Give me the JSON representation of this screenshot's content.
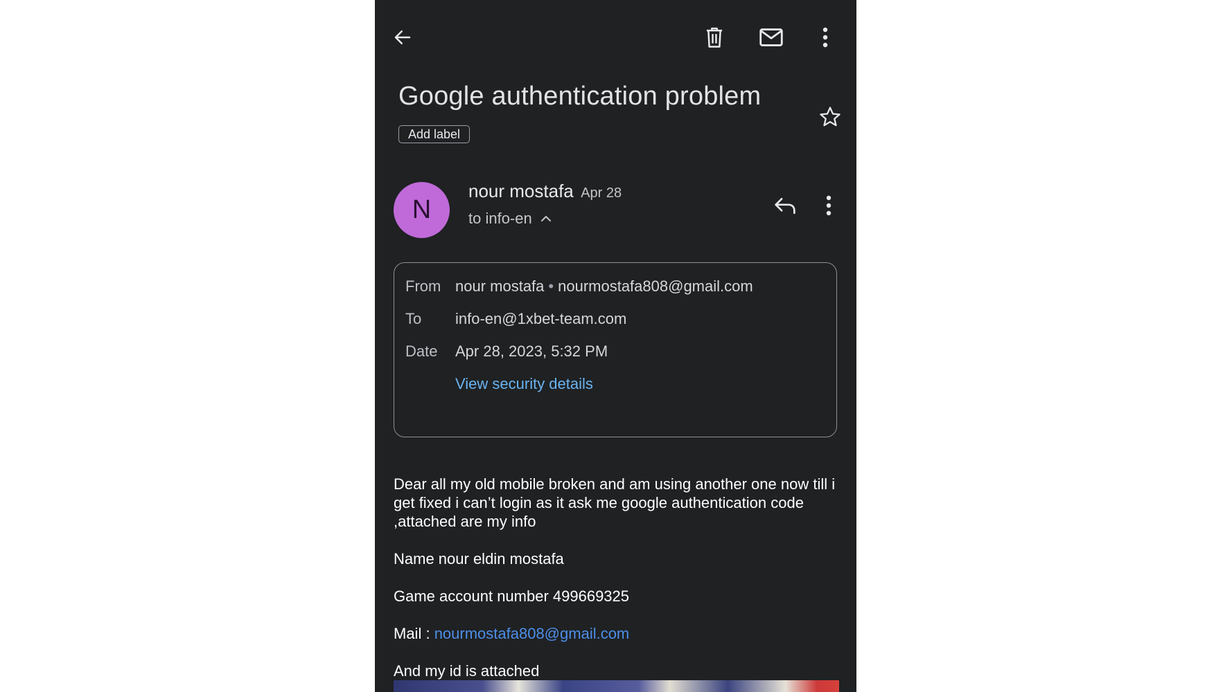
{
  "toolbar": {
    "back_icon": "arrow-left-icon",
    "delete_icon": "trash-icon",
    "mark_unread_icon": "mail-icon",
    "more_icon": "more-vert-icon"
  },
  "email": {
    "subject": "Google authentication problem",
    "add_label": "Add label",
    "star_icon": "star-outline-icon"
  },
  "sender": {
    "avatar_letter": "N",
    "avatar_color": "#bf6ad8",
    "name": "nour mostafa",
    "date": "Apr 28",
    "to_line": "to info-en",
    "reply_icon": "reply-icon",
    "more_icon": "more-vert-icon"
  },
  "details": {
    "from_label": "From",
    "from_name": "nour mostafa",
    "from_email": "nourmostafa808@gmail.com",
    "to_label": "To",
    "to_value": "info-en@1xbet-team.com",
    "date_label": "Date",
    "date_value": "Apr 28, 2023, 5:32 PM",
    "security_link": "View security details",
    "link_color": "#6ab3f0"
  },
  "body": {
    "paragraph1": "Dear all my old mobile broken and am using another one now till i get fixed i can’t login as it ask me google authentication code ,attached are my info",
    "name_line": "Name nour eldin mostafa",
    "account_line": "Game account number 499669325",
    "mail_prefix": "Mail : ",
    "mail_link": "nourmostafa808@gmail.com",
    "attached_line": "And my id is attached"
  },
  "theme": {
    "background": "#1f2123",
    "text": "#e8eaed"
  }
}
